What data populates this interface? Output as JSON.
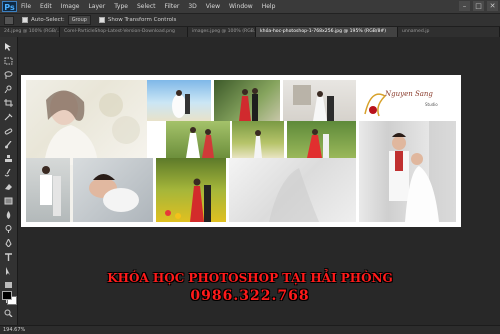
{
  "app": {
    "logo": "Ps"
  },
  "menu": [
    "File",
    "Edit",
    "Image",
    "Layer",
    "Type",
    "Select",
    "Filter",
    "3D",
    "View",
    "Window",
    "Help"
  ],
  "window_controls": [
    "–",
    "□",
    "✕"
  ],
  "options_bar": {
    "auto_select_label": "Auto-Select:",
    "auto_select_value": "Group",
    "show_transform_label": "Show Transform Controls"
  },
  "tabs": [
    "24.jpeg @ 100% (RGB/...",
    "Corel-ParticleShop-Latest-Version-Download.png",
    "images.jpeg @ 100% (RGB...",
    "khóa-hoc-photoshop-1-768x256.jpg @ 195% (RGB/8#)",
    "unnamed.jp"
  ],
  "active_tab_index": 3,
  "canvas": {
    "logo_line1": "Nguyen Sang",
    "logo_line2": "Studio"
  },
  "overlay": {
    "headline": "KHÓA HỌC PHOTOSHOP TẠI HẢI PHÒNG",
    "phone": "0986.322.768"
  },
  "status": {
    "zoom": "194.67%"
  },
  "colors": {
    "overlay_text": "#ff1a1a",
    "active_tab": "#424242"
  }
}
